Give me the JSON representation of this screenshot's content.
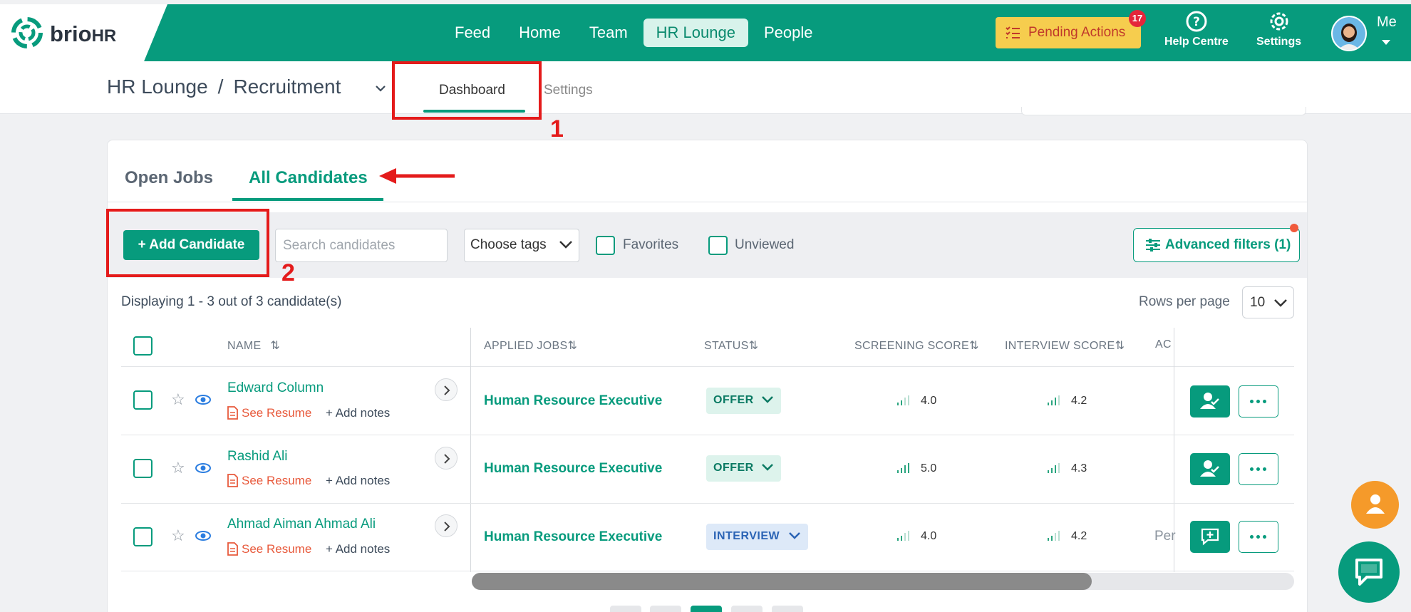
{
  "app": {
    "logo_brio": "brio",
    "logo_hr": "HR"
  },
  "nav": {
    "items": [
      "Feed",
      "Home",
      "Team",
      "HR Lounge",
      "People"
    ],
    "active": "HR Lounge"
  },
  "topbar": {
    "pending_label": "Pending Actions",
    "pending_count": "17",
    "help_label": "Help Centre",
    "settings_label": "Settings",
    "me_label": "Me"
  },
  "breadcrumb": {
    "root": "HR Lounge",
    "separator": "/",
    "current": "Recruitment"
  },
  "subtabs": {
    "dashboard": "Dashboard",
    "settings": "Settings"
  },
  "annotations": {
    "step1": "1",
    "step2": "2"
  },
  "tabs": {
    "open_jobs": "Open Jobs",
    "all_candidates": "All Candidates"
  },
  "toolbar": {
    "add_candidate": "+ Add Candidate",
    "search_placeholder": "Search candidates",
    "choose_tags": "Choose tags",
    "favorites": "Favorites",
    "unviewed": "Unviewed",
    "advanced_filters": "Advanced filters (1)"
  },
  "listing": {
    "displaying": "Displaying 1 - 3 out of 3 candidate(s)",
    "rows_per_page_label": "Rows per page",
    "rows_per_page_value": "10"
  },
  "table": {
    "headers": {
      "name": "NAME",
      "applied_jobs": "APPLIED JOBS",
      "status": "STATUS",
      "screening_score": "SCREENING SCORE",
      "interview_score": "INTERVIEW SCORE",
      "action_partial": "AC"
    },
    "see_resume": "See Resume",
    "add_notes": "+ Add notes",
    "rows": [
      {
        "name": "Edward Column",
        "job": "Human Resource Executive",
        "status": "OFFER",
        "screening": "4.0",
        "interview": "4.2",
        "extra": ""
      },
      {
        "name": "Rashid Ali",
        "job": "Human Resource Executive",
        "status": "OFFER",
        "screening": "5.0",
        "interview": "4.3",
        "extra": ""
      },
      {
        "name": "Ahmad Aiman Ahmad Ali",
        "job": "Human Resource Executive",
        "status": "INTERVIEW",
        "screening": "4.0",
        "interview": "4.2",
        "extra": "Per"
      }
    ]
  },
  "colors": {
    "brand": "#079b7d",
    "annotation": "#e41b1b",
    "pending": "#f6cd4e"
  }
}
